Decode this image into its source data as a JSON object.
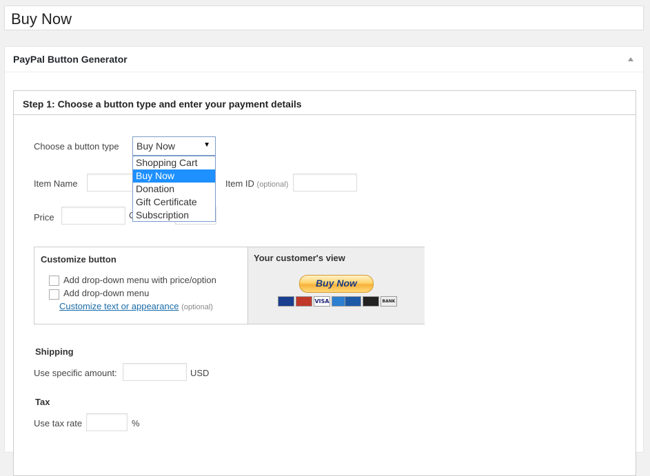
{
  "page": {
    "title": "Buy Now"
  },
  "postbox": {
    "title": "PayPal Button Generator"
  },
  "step1": {
    "title": "Step 1: Choose a button type and enter your payment details",
    "button_type_label": "Choose a button type",
    "button_type_value": "Buy Now",
    "button_type_options": [
      "Shopping Cart",
      "Buy Now",
      "Donation",
      "Gift Certificate",
      "Subscription"
    ],
    "item_name_label": "Item Name",
    "item_id_label": "Item ID",
    "item_id_optional": "(optional)",
    "price_label": "Price",
    "currency_label_partial": "C"
  },
  "customize": {
    "title": "Customize button",
    "option1": "Add drop-down menu with price/option",
    "option2": "Add drop-down menu",
    "link": "Customize text or appearance",
    "link_optional": "(optional)"
  },
  "customer_view": {
    "title": "Your customer's view",
    "button_label": "Buy Now",
    "cards": [
      "Maestro",
      "MasterCard",
      "VISA",
      "AMEX",
      "Discover",
      "DISCOVER",
      "BANK"
    ]
  },
  "shipping": {
    "title": "Shipping",
    "label": "Use specific amount:",
    "unit": "USD"
  },
  "tax": {
    "title": "Tax",
    "label": "Use tax rate",
    "unit": "%"
  },
  "colors": {
    "accent": "#1e90ff",
    "link": "#1a6ba8",
    "paypal_button": "#ffc439"
  }
}
